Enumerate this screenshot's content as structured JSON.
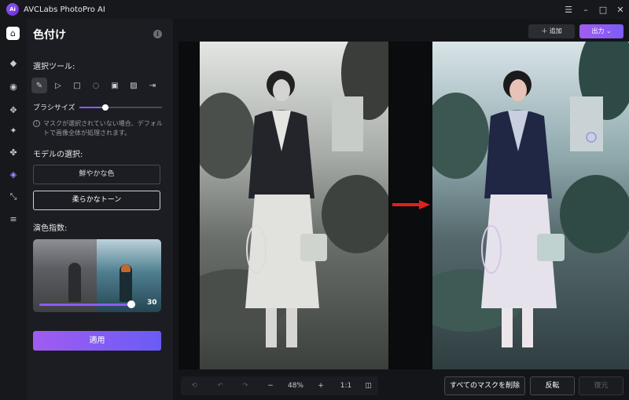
{
  "app": {
    "title": "AVCLabs PhotoPro AI",
    "logo_text": "Ai"
  },
  "window_controls": [
    "☰",
    "–",
    "□",
    "✕"
  ],
  "panel": {
    "title": "色付け",
    "select_tool_label": "選択ツール:",
    "brush_size_label": "ブラシサイズ",
    "brush_size_level": 0.3,
    "hint": "マスクが選択されていない場合、デフォルトで画像全体が処理されます。",
    "model_label": "モデルの選択:",
    "model_options": [
      "鮮やかな色",
      "柔らかなトーン"
    ],
    "model_selected": "柔らかなトーン",
    "intensity_label": "演色指数:",
    "intensity_value": "30",
    "apply_label": "適用"
  },
  "toolbar": {
    "add_label": "＋ 追加",
    "output_label": "出力 ⌄"
  },
  "zoom": {
    "level": "48%",
    "one_to_one": "1:1"
  },
  "actions": {
    "clear_masks": "すべてのマスクを削除",
    "invert": "反転",
    "restore": "復元"
  },
  "colors": {
    "accent": "#8b5cf6",
    "arrow": "#e0201c"
  }
}
